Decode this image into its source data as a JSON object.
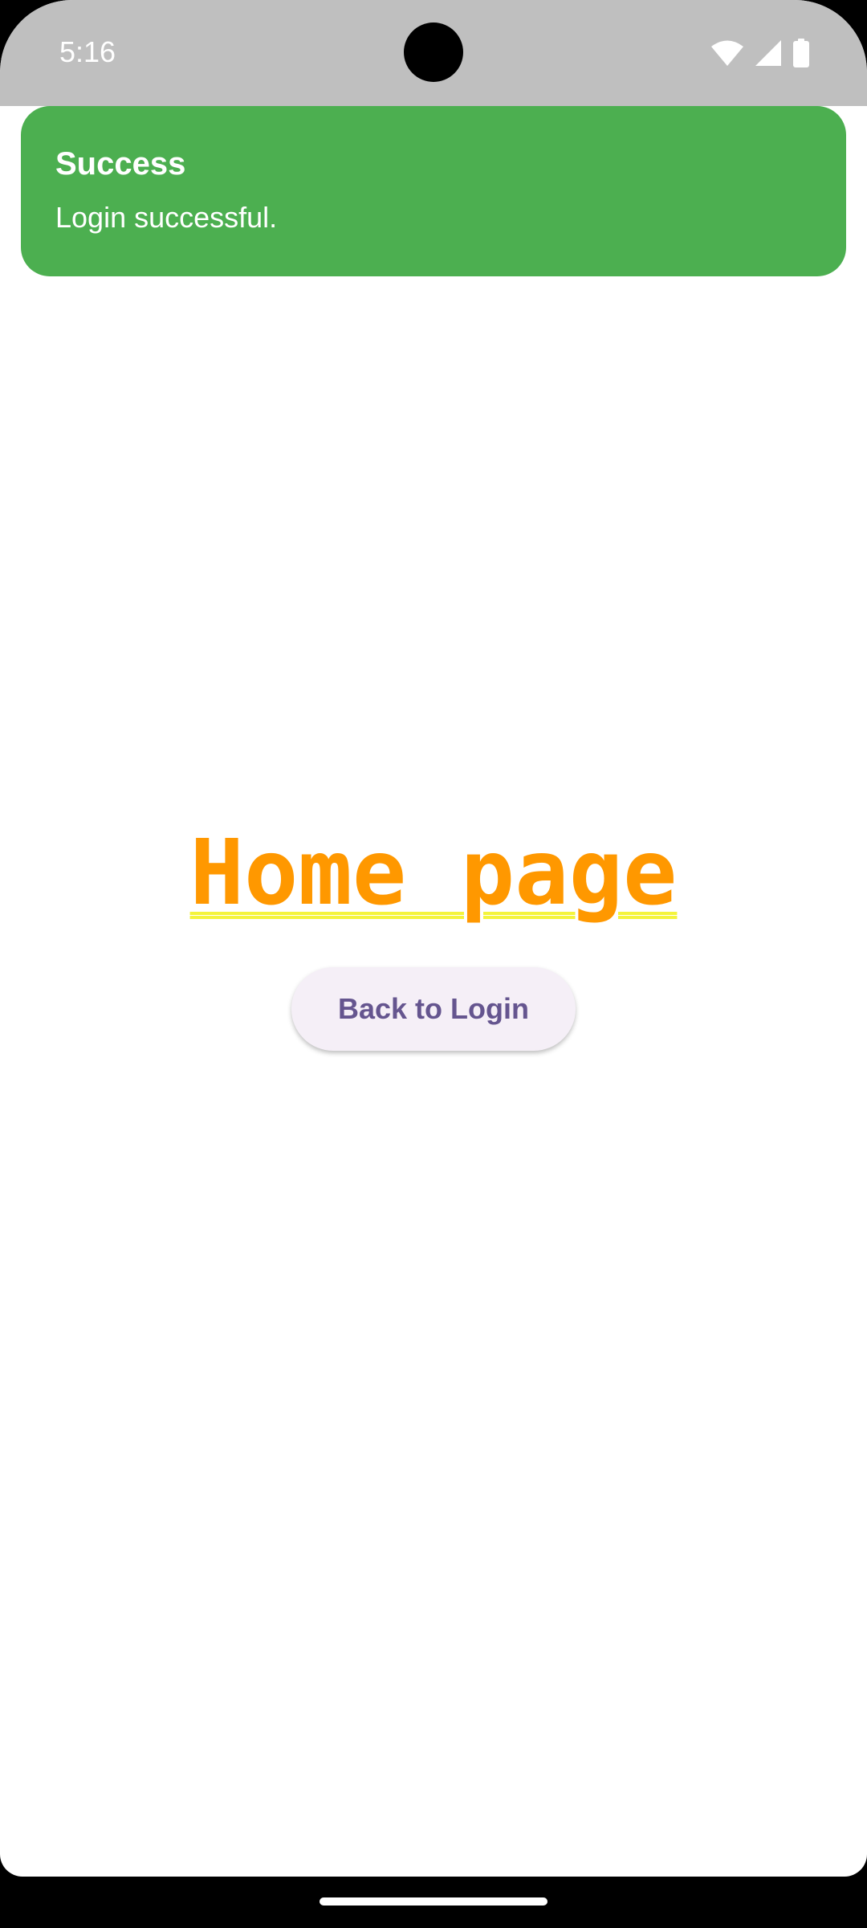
{
  "status_bar": {
    "time": "5:16",
    "icons": [
      "wifi-icon",
      "cellular-signal-icon",
      "battery-icon"
    ]
  },
  "snackbar": {
    "title": "Success",
    "message": "Login successful.",
    "color": "#4caf50"
  },
  "home": {
    "title": "Home page",
    "title_color": "#ff9800",
    "underline_color": "#f4f43c",
    "button_label": "Back to Login"
  }
}
